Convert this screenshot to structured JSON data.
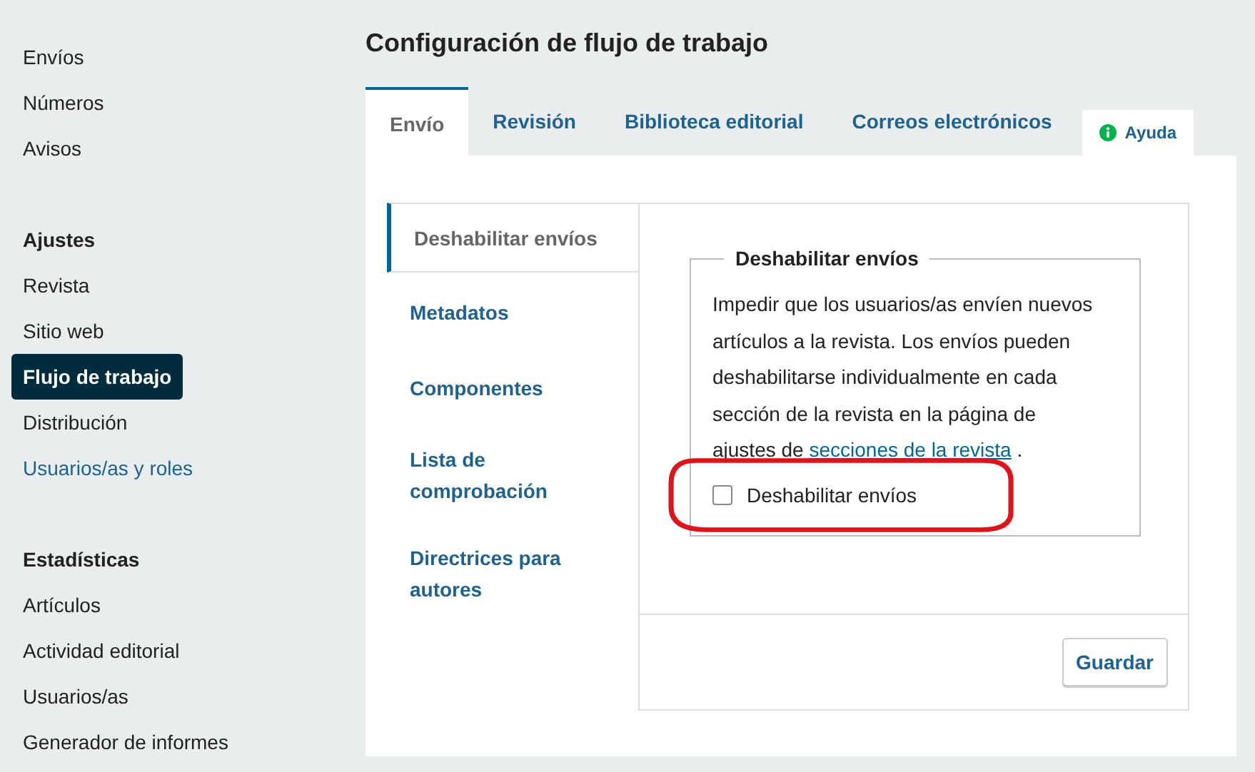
{
  "sidebar": {
    "groups": [
      {
        "items": [
          {
            "label": "Envíos",
            "selected": false,
            "kind": "plain"
          },
          {
            "label": "Números",
            "selected": false,
            "kind": "plain"
          },
          {
            "label": "Avisos",
            "selected": false,
            "kind": "plain"
          }
        ]
      },
      {
        "heading": "Ajustes",
        "items": [
          {
            "label": "Revista",
            "selected": false,
            "kind": "plain"
          },
          {
            "label": "Sitio web",
            "selected": false,
            "kind": "plain"
          },
          {
            "label": "Flujo de trabajo",
            "selected": true,
            "kind": "plain"
          },
          {
            "label": "Distribución",
            "selected": false,
            "kind": "plain"
          },
          {
            "label": "Usuarios/as y roles",
            "selected": false,
            "kind": "link"
          }
        ]
      },
      {
        "heading": "Estadísticas",
        "items": [
          {
            "label": "Artículos",
            "selected": false,
            "kind": "plain"
          },
          {
            "label": "Actividad editorial",
            "selected": false,
            "kind": "plain"
          },
          {
            "label": "Usuarios/as",
            "selected": false,
            "kind": "plain"
          },
          {
            "label": "Generador de informes",
            "selected": false,
            "kind": "plain"
          }
        ]
      }
    ]
  },
  "page_title": "Configuración de flujo de trabajo",
  "tabs": [
    {
      "label": "Envío",
      "selected": true
    },
    {
      "label": "Revisión",
      "selected": false
    },
    {
      "label": "Biblioteca editorial",
      "selected": false
    },
    {
      "label": "Correos electrónicos",
      "selected": false
    }
  ],
  "help_tab": {
    "label": "Ayuda"
  },
  "subtabs": [
    {
      "label": "Deshabilitar envíos",
      "selected": true
    },
    {
      "label": "Metadatos",
      "selected": false
    },
    {
      "label": "Componentes",
      "selected": false
    },
    {
      "label": "Lista de comprobación",
      "selected": false
    },
    {
      "label": "Directrices para autores",
      "selected": false
    }
  ],
  "fieldset": {
    "legend": "Deshabilitar envíos",
    "description_before": "Impedir que los usuarios/as envíen nuevos artículos a la revista. Los envíos pueden deshabilitarse individualmente en cada sección de la revista en la página de ajustes de ",
    "description_link": "secciones de la revista",
    "description_after": " .",
    "checkbox": {
      "label": "Deshabilitar envíos",
      "checked": false
    }
  },
  "save_button": "Guardar"
}
